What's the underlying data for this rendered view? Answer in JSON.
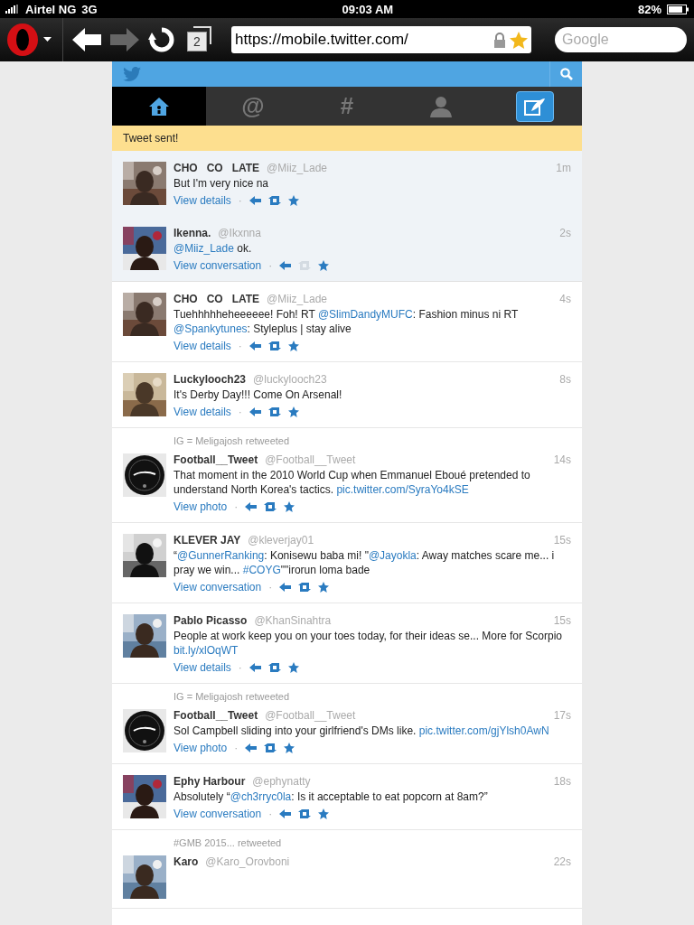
{
  "status_bar": {
    "carrier": "Airtel NG",
    "network": "3G",
    "time": "09:03 AM",
    "battery": "82%"
  },
  "browser": {
    "tab_count": "2",
    "forward_disabled": true,
    "url": "https://mobile.twitter.com/",
    "search_placeholder": "Google"
  },
  "nav_tabs": [
    {
      "kind": "home",
      "selected": true
    },
    {
      "kind": "text",
      "label": "@",
      "selected": false
    },
    {
      "kind": "text",
      "label": "#",
      "selected": false
    },
    {
      "kind": "person",
      "selected": false
    },
    {
      "kind": "compose",
      "selected": false
    }
  ],
  "notice": "Tweet sent!",
  "tweets": [
    {
      "highlighted": true,
      "name": "CHO   CO   LATE",
      "handle": "@Miiz_Lade",
      "time": "1m",
      "body": [
        {
          "kind": "text",
          "text": "But I'm very nice na"
        }
      ],
      "action": "View details",
      "separator": "·",
      "retweet_disabled": false
    },
    {
      "highlighted": true,
      "name": "Ikenna.",
      "handle": "@Ikxnna",
      "time": "2s",
      "body": [
        {
          "kind": "link",
          "text": "@Miiz_Lade"
        },
        {
          "kind": "text",
          "text": " ok."
        }
      ],
      "action": "View conversation",
      "separator": "·",
      "retweet_disabled": true
    },
    {
      "highlighted": false,
      "name": "CHO   CO   LATE",
      "handle": "@Miiz_Lade",
      "time": "4s",
      "body": [
        {
          "kind": "text",
          "text": "Tuehhhhheheeeeee! Foh! RT "
        },
        {
          "kind": "link",
          "text": "@SlimDandyMUFC"
        },
        {
          "kind": "text",
          "text": ": Fashion minus ni RT "
        },
        {
          "kind": "link",
          "text": "@Spankytunes"
        },
        {
          "kind": "text",
          "text": ": Styleplus | stay alive"
        }
      ],
      "action": "View details",
      "separator": "·",
      "retweet_disabled": false
    },
    {
      "highlighted": false,
      "name": "Luckylooch23",
      "handle": "@luckylooch23",
      "time": "8s",
      "body": [
        {
          "kind": "text",
          "text": "It's Derby Day!!! Come On Arsenal!"
        }
      ],
      "action": "View details",
      "separator": "·",
      "retweet_disabled": false
    },
    {
      "highlighted": false,
      "retweeted_by": "IG = Meligajosh retweeted",
      "name": "Football__Tweet",
      "handle": "@Football__Tweet",
      "time": "14s",
      "body": [
        {
          "kind": "text",
          "text": "That moment in the 2010 World Cup when Emmanuel Eboué pretended to understand North Korea's tactics. "
        },
        {
          "kind": "link",
          "text": "pic.twitter.com/SyraYo4kSE"
        }
      ],
      "action": "View photo",
      "separator": "·",
      "retweet_disabled": false
    },
    {
      "highlighted": false,
      "name": "KLEVER JAY",
      "handle": "@kleverjay01",
      "time": "15s",
      "body": [
        {
          "kind": "text",
          "text": "“"
        },
        {
          "kind": "link",
          "text": "@GunnerRanking"
        },
        {
          "kind": "text",
          "text": ": Konisewu baba mi! \""
        },
        {
          "kind": "link",
          "text": "@Jayokla"
        },
        {
          "kind": "text",
          "text": ": Away matches scare me... i pray we win... "
        },
        {
          "kind": "link",
          "text": "#COYG"
        },
        {
          "kind": "text",
          "text": "\"\"irorun loma bade"
        }
      ],
      "action": "View conversation",
      "separator": "·",
      "retweet_disabled": false
    },
    {
      "highlighted": false,
      "name": "Pablo Picasso",
      "handle": "@KhanSinahtra",
      "time": "15s",
      "body": [
        {
          "kind": "text",
          "text": "People at work keep you on your toes today, for their ideas se... More for Scorpio "
        },
        {
          "kind": "link",
          "text": "bit.ly/xlOqWT"
        }
      ],
      "action": "View details",
      "separator": "·",
      "retweet_disabled": false
    },
    {
      "highlighted": false,
      "retweeted_by": "IG = Meligajosh retweeted",
      "name": "Football__Tweet",
      "handle": "@Football__Tweet",
      "time": "17s",
      "body": [
        {
          "kind": "text",
          "text": "Sol Campbell sliding into your girlfriend's DMs like. "
        },
        {
          "kind": "link",
          "text": "pic.twitter.com/gjYlsh0AwN"
        }
      ],
      "action": "View photo",
      "separator": "·",
      "retweet_disabled": false
    },
    {
      "highlighted": false,
      "name": "Ephy Harbour",
      "handle": "@ephynatty",
      "time": "18s",
      "body": [
        {
          "kind": "text",
          "text": "Absolutely “"
        },
        {
          "kind": "link",
          "text": "@ch3rryc0la"
        },
        {
          "kind": "text",
          "text": ": Is it acceptable to eat popcorn at 8am?”"
        }
      ],
      "action": "View conversation",
      "separator": "·",
      "retweet_disabled": false
    },
    {
      "highlighted": false,
      "retweeted_by": "#GMB 2015... retweeted",
      "name": "Karo",
      "handle": "@Karo_Orovboni",
      "time": "22s"
    }
  ]
}
